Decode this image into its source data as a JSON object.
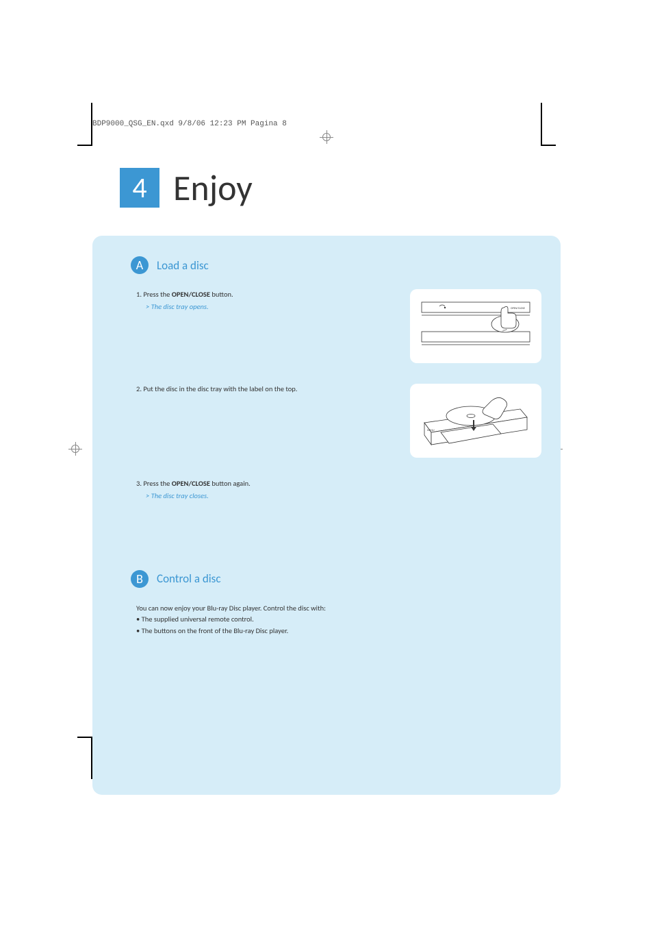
{
  "header": "BDP9000_QSG_EN.qxd  9/8/06  12:23 PM  Pagina 8",
  "chapter": {
    "number": "4",
    "title": "Enjoy"
  },
  "sectionA": {
    "badge": "A",
    "title": "Load a disc",
    "step1_prefix": "1.  Press the ",
    "step1_bold": "OPEN/CLOSE",
    "step1_suffix": " button.",
    "step1_result": "> The disc tray opens.",
    "step2": "2. Put the disc in the disc tray with the label on the top.",
    "step3_prefix": "3. Press the ",
    "step3_bold": "OPEN/CLOSE",
    "step3_suffix": " button again.",
    "step3_result": "> The disc tray closes."
  },
  "sectionB": {
    "badge": "B",
    "title": "Control a disc",
    "intro": "You can now enjoy your Blu-ray Disc player. Control the disc with:",
    "bullet1": "The supplied universal remote control.",
    "bullet2": "The buttons on the front of the Blu-ray Disc player."
  }
}
